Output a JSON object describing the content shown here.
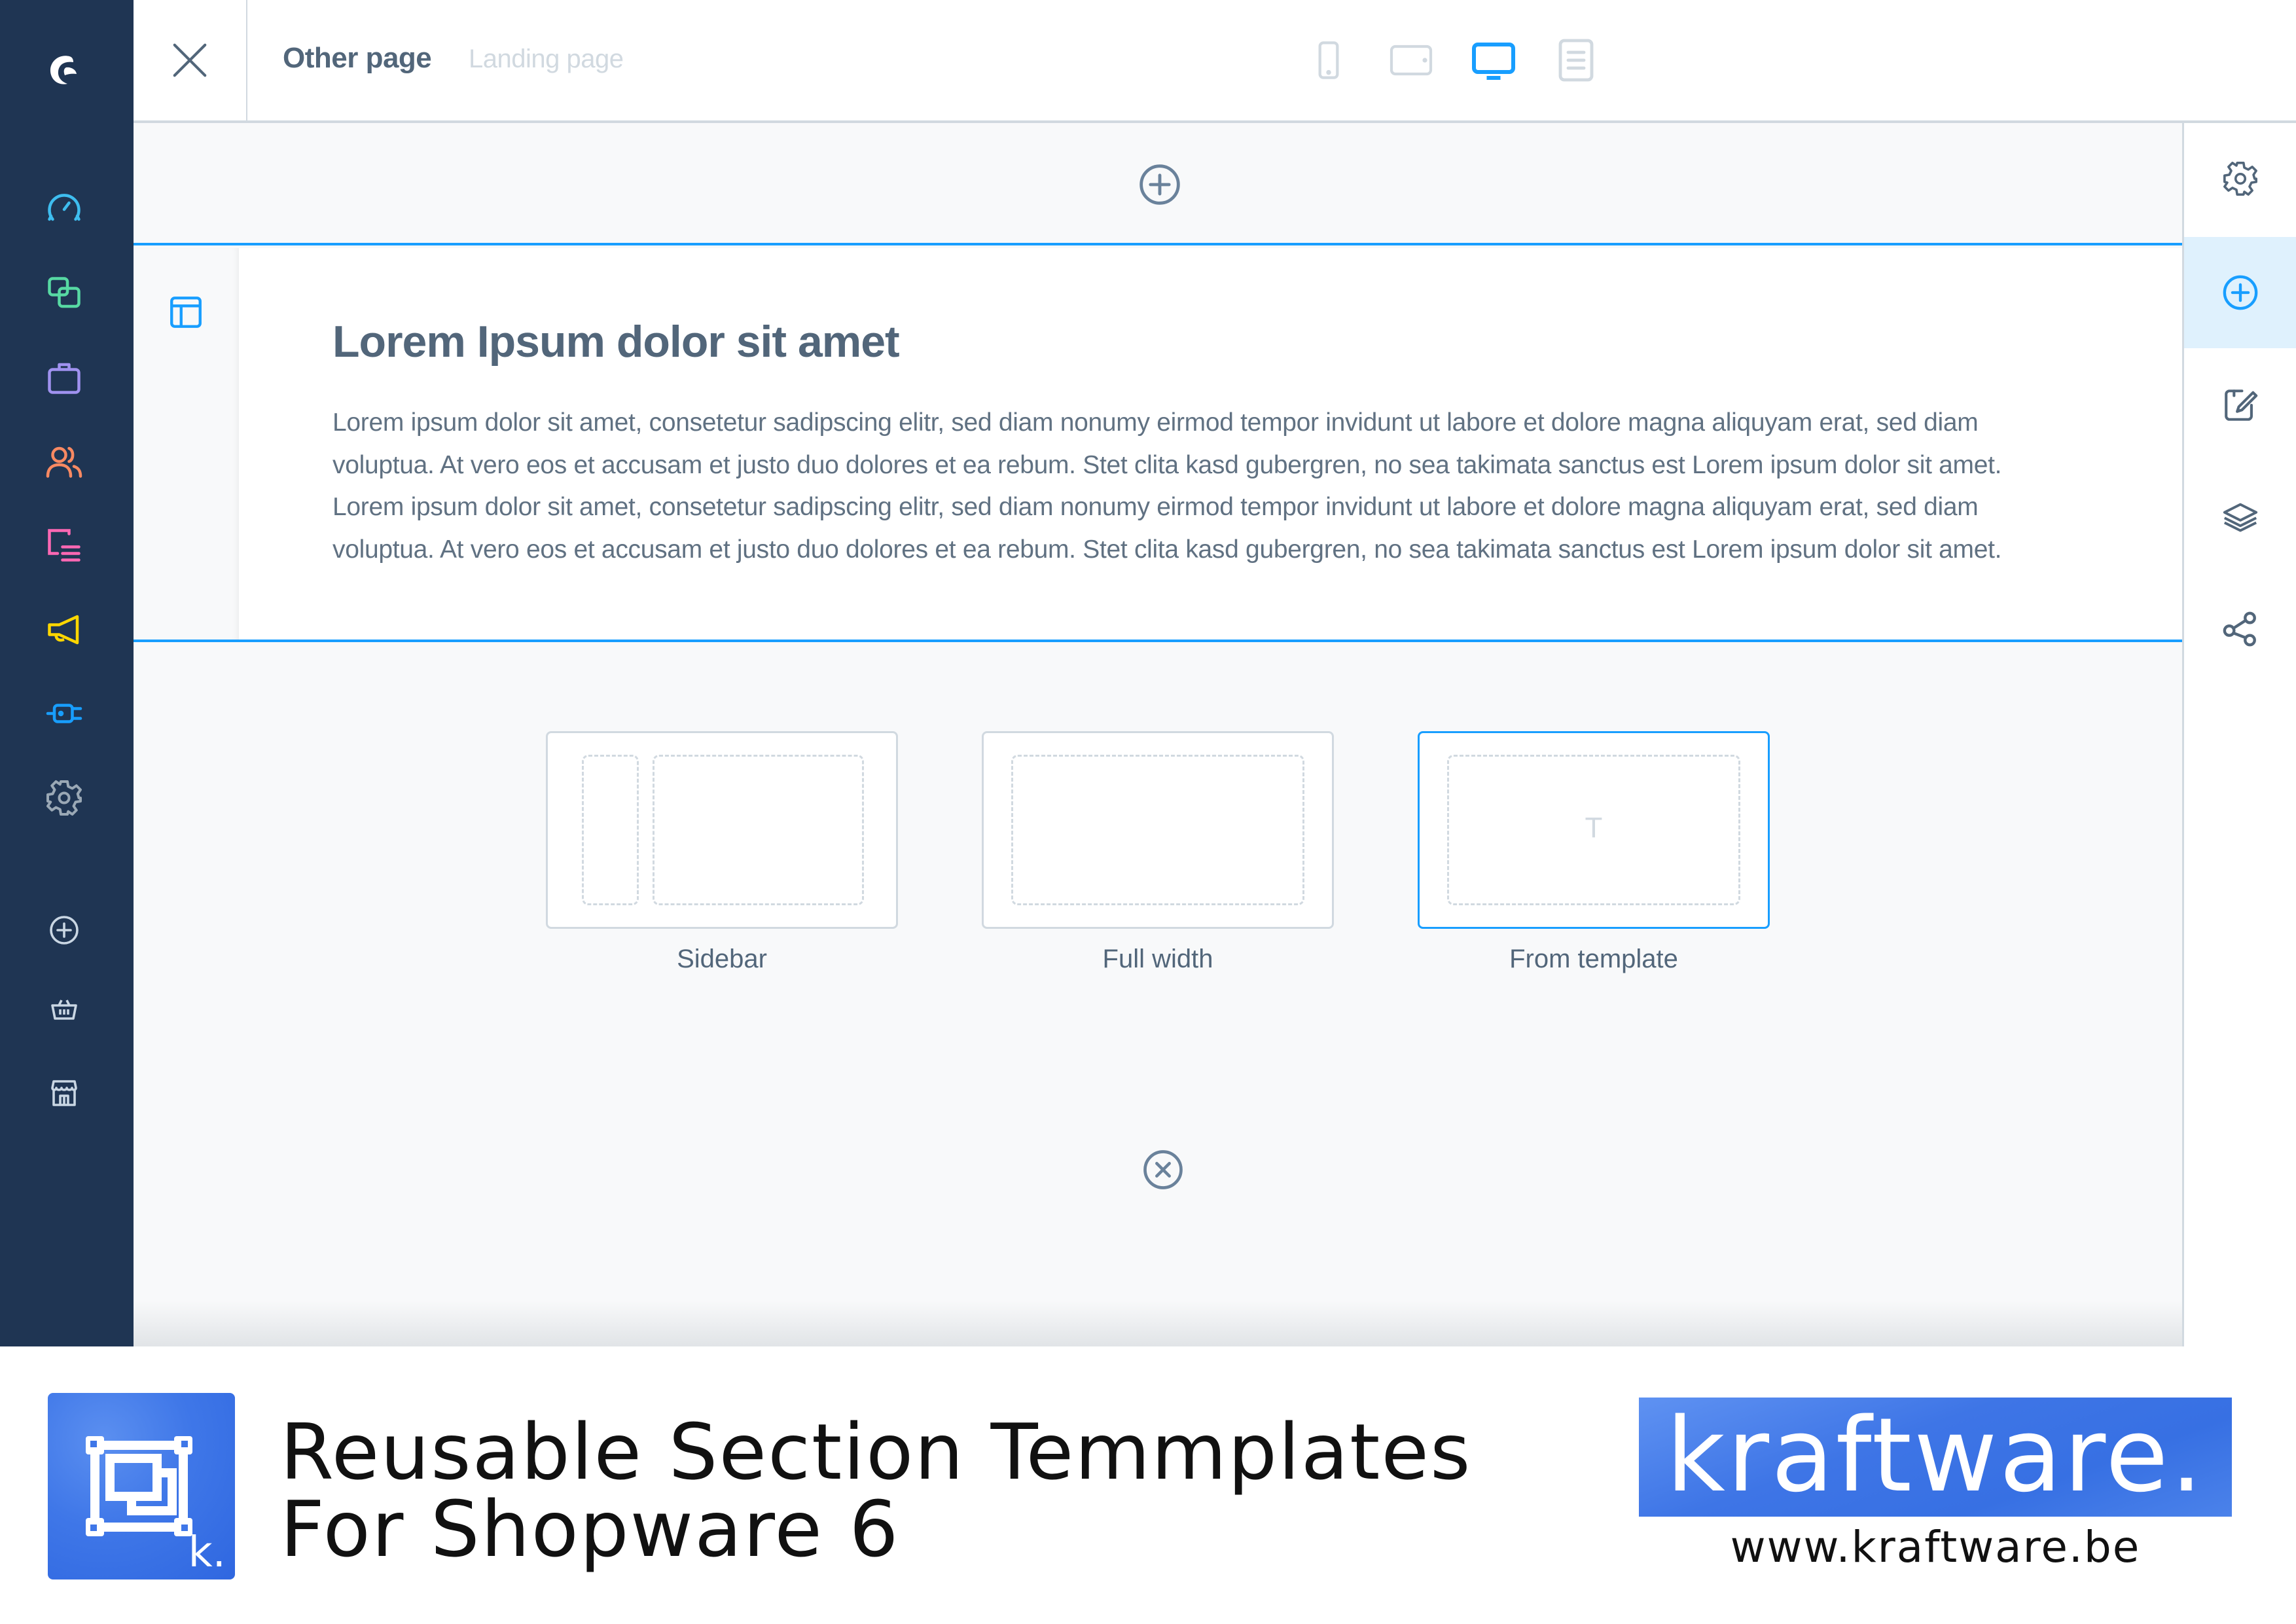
{
  "app": {
    "sidebar": {
      "logo": "shopware-logo",
      "items": [
        {
          "name": "dashboard",
          "icon": "gauge-icon",
          "color": "#3ebdef"
        },
        {
          "name": "catalogues",
          "icon": "products-stack-icon",
          "color": "#57d9a3"
        },
        {
          "name": "orders",
          "icon": "shopping-bag-icon",
          "color": "#a092f0"
        },
        {
          "name": "customers",
          "icon": "users-icon",
          "color": "#f88962"
        },
        {
          "name": "content",
          "icon": "content-list-icon",
          "color": "#ff68b4"
        },
        {
          "name": "marketing",
          "icon": "megaphone-icon",
          "color": "#ffd700"
        },
        {
          "name": "extensions",
          "icon": "plug-icon",
          "color": "#189eff"
        },
        {
          "name": "settings",
          "icon": "gear-icon",
          "color": "#9aa8b5"
        }
      ],
      "shortcuts": [
        {
          "name": "add",
          "icon": "plus-circle-icon"
        },
        {
          "name": "basket",
          "icon": "basket-icon"
        },
        {
          "name": "storefront",
          "icon": "storefront-icon"
        }
      ]
    },
    "header": {
      "close_icon": "close-icon",
      "title": "Other page",
      "subtitle": "Landing page",
      "devices": [
        {
          "name": "mobile",
          "icon": "mobile-icon",
          "active": false
        },
        {
          "name": "tablet",
          "icon": "tablet-icon",
          "active": false
        },
        {
          "name": "desktop",
          "icon": "desktop-icon",
          "active": true
        },
        {
          "name": "form",
          "icon": "list-document-icon",
          "active": false
        }
      ]
    },
    "right_panel": {
      "items": [
        {
          "name": "settings",
          "icon": "gear-icon",
          "active": false
        },
        {
          "name": "add-blocks",
          "icon": "plus-circle-icon",
          "active": true
        },
        {
          "name": "edit",
          "icon": "edit-document-icon",
          "active": false
        },
        {
          "name": "layers",
          "icon": "layers-icon",
          "active": false
        },
        {
          "name": "assignment",
          "icon": "share-nodes-icon",
          "active": false
        }
      ]
    },
    "canvas": {
      "add_section_icon": "plus-circle-icon",
      "section": {
        "layout_icon": "layout-sidebar-icon",
        "heading": "Lorem Ipsum dolor sit amet",
        "body_lines": [
          "Lorem ipsum dolor sit amet, consetetur sadipscing elitr, sed diam nonumy eirmod tempor invidunt ut labore et dolore magna aliquyam erat, sed diam",
          "voluptua. At vero eos et accusam et justo duo dolores et ea rebum. Stet clita kasd gubergren, no sea takimata sanctus est Lorem ipsum dolor sit amet.",
          "Lorem ipsum dolor sit amet, consetetur sadipscing elitr, sed diam nonumy eirmod tempor invidunt ut labore et dolore magna aliquyam erat, sed diam",
          "voluptua. At vero eos et accusam et justo duo dolores et ea rebum. Stet clita kasd gubergren, no sea takimata sanctus est Lorem ipsum dolor sit amet."
        ]
      },
      "section_types": [
        {
          "name": "sidebar",
          "label": "Sidebar",
          "selected": false
        },
        {
          "name": "full-width",
          "label": "Full width",
          "selected": false
        },
        {
          "name": "from-template",
          "label": "From template",
          "selected": true,
          "glyph": "T"
        }
      ],
      "dismiss_icon": "close-circle-icon"
    }
  },
  "promo": {
    "badge_letter": "k.",
    "title_line1": "Reusable Section Temmplates",
    "title_line2": "For Shopware 6",
    "brand": "kraftware.",
    "url": "www.kraftware.be"
  },
  "colors": {
    "sidebar_bg": "#1f3553",
    "accent": "#189eff",
    "text": "#52667a",
    "border": "#d1d9e0",
    "brand_blue": "#3f77e8"
  }
}
